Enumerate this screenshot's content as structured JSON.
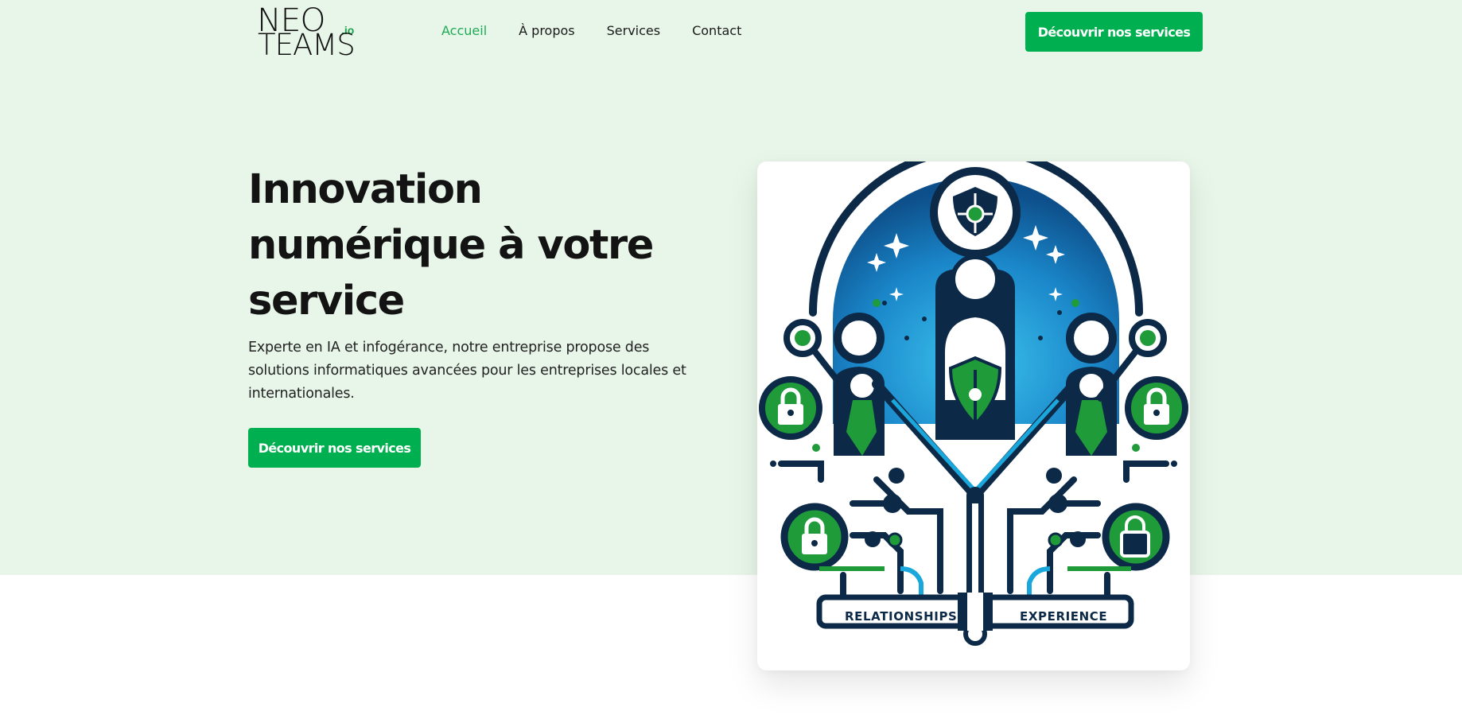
{
  "brand": {
    "line1": "NEO",
    "line2": "TEAMS",
    "suffix": ".io"
  },
  "nav": [
    {
      "label": "Accueil",
      "active": true
    },
    {
      "label": "À propos",
      "active": false
    },
    {
      "label": "Services",
      "active": false
    },
    {
      "label": "Contact",
      "active": false
    }
  ],
  "header": {
    "cta_label": "Découvrir nos services"
  },
  "hero": {
    "title": "Innovation numérique à votre service",
    "subtitle": "Experte en IA et infogérance, notre entreprise propose des solutions informatiques avancées pour les entreprises locales et internationales.",
    "cta_label": "Découvrir nos services"
  },
  "illustration": {
    "left_label": "RELATIONSHIPS",
    "right_label": "EXPERIENCE",
    "colors": {
      "navy": "#0c2a48",
      "green": "#1f9b3a",
      "blue": "#1aa7dc"
    }
  },
  "colors": {
    "accent": "#00b050",
    "hero_bg": "#e8f6e9",
    "nav_active": "#1faa55"
  }
}
